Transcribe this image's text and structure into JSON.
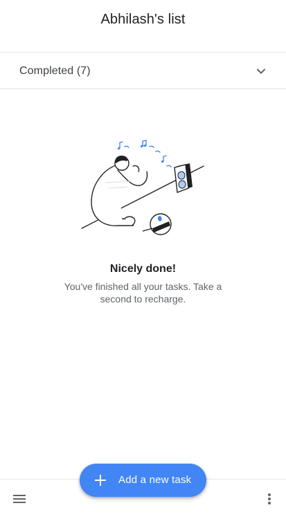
{
  "header": {
    "title": "Abhilash's list"
  },
  "completed_section": {
    "label": "Completed (7)",
    "expand_icon": "chevron-down-icon"
  },
  "empty_state": {
    "title": "Nicely done!",
    "subtitle": "You've finished all your tasks. Take a second to recharge."
  },
  "fab": {
    "label": "Add a new task",
    "icon": "plus-icon",
    "color": "#4285f4"
  },
  "bottom_bar": {
    "menu_icon": "menu-icon",
    "more_icon": "more-vert-icon"
  },
  "colors": {
    "accent": "#4285f4",
    "text_primary": "#202124",
    "text_secondary": "#5f6368",
    "divider": "#e4e4e4"
  }
}
